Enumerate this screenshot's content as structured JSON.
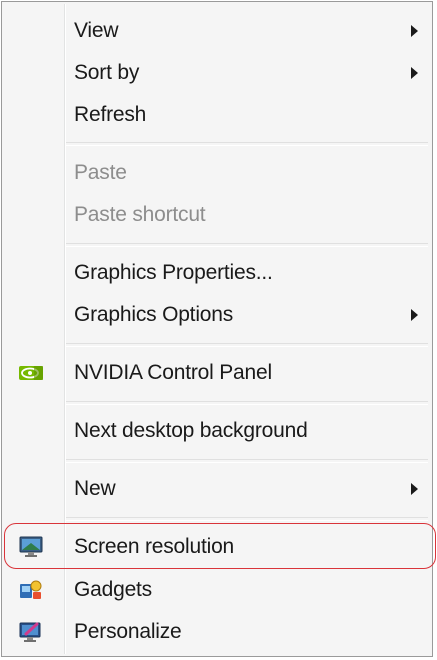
{
  "menu": {
    "items": [
      {
        "label": "View",
        "submenu": true,
        "disabled": false
      },
      {
        "label": "Sort by",
        "submenu": true,
        "disabled": false
      },
      {
        "label": "Refresh",
        "submenu": false,
        "disabled": false
      },
      {
        "label": "Paste",
        "submenu": false,
        "disabled": true
      },
      {
        "label": "Paste shortcut",
        "submenu": false,
        "disabled": true
      },
      {
        "label": "Graphics Properties...",
        "submenu": false,
        "disabled": false
      },
      {
        "label": "Graphics Options",
        "submenu": true,
        "disabled": false
      },
      {
        "label": "NVIDIA Control Panel",
        "submenu": false,
        "disabled": false,
        "icon": "nvidia-icon"
      },
      {
        "label": "Next desktop background",
        "submenu": false,
        "disabled": false
      },
      {
        "label": "New",
        "submenu": true,
        "disabled": false
      },
      {
        "label": "Screen resolution",
        "submenu": false,
        "disabled": false,
        "icon": "monitor-icon",
        "highlighted": true
      },
      {
        "label": "Gadgets",
        "submenu": false,
        "disabled": false,
        "icon": "gadgets-icon"
      },
      {
        "label": "Personalize",
        "submenu": false,
        "disabled": false,
        "icon": "personalize-icon"
      }
    ]
  },
  "colors": {
    "menu_background": "#f5f5f5",
    "text": "#1a1a1a",
    "disabled_text": "#8d8d8d",
    "highlight_outline": "#d9343a",
    "nvidia_green": "#76b900"
  }
}
